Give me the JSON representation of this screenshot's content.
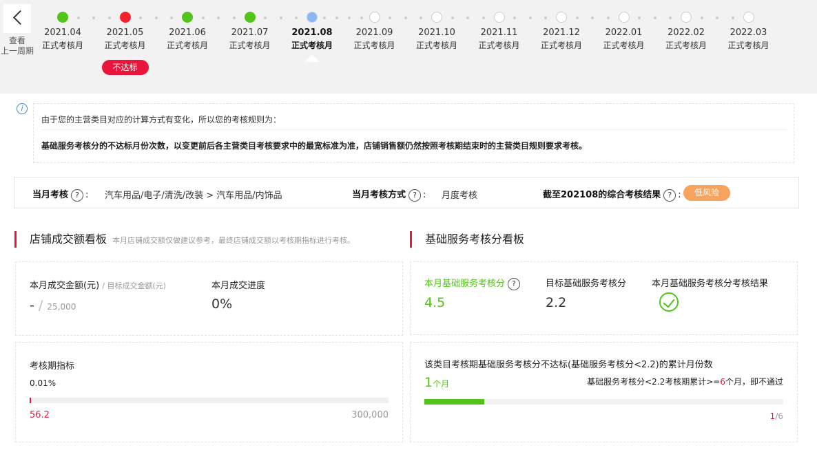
{
  "back": {
    "label_line1": "查看",
    "label_line2": "上一周期"
  },
  "timeline": [
    {
      "date": "2021.04",
      "type": "正式考核月",
      "status": "green"
    },
    {
      "date": "2021.05",
      "type": "正式考核月",
      "status": "red",
      "badge": "不达标"
    },
    {
      "date": "2021.06",
      "type": "正式考核月",
      "status": "green"
    },
    {
      "date": "2021.07",
      "type": "正式考核月",
      "status": "green"
    },
    {
      "date": "2021.08",
      "type": "正式考核月",
      "status": "current"
    },
    {
      "date": "2021.09",
      "type": "正式考核月",
      "status": "empty"
    },
    {
      "date": "2021.10",
      "type": "正式考核月",
      "status": "empty"
    },
    {
      "date": "2021.11",
      "type": "正式考核月",
      "status": "empty"
    },
    {
      "date": "2021.12",
      "type": "正式考核月",
      "status": "empty"
    },
    {
      "date": "2022.01",
      "type": "正式考核月",
      "status": "empty"
    },
    {
      "date": "2022.02",
      "type": "正式考核月",
      "status": "empty"
    },
    {
      "date": "2022.03",
      "type": "正式考核月",
      "status": "empty"
    }
  ],
  "notice": {
    "icon_text": "i",
    "line1": "由于您的主营类目对应的计算方式有变化，所以您的考核规则为：",
    "line2": "基础服务考核分的不达标月份次数，以变更前后各主营类目考核要求中的最宽标准为准，店铺销售额仍然按照考核期结束时的主营类目规则要求考核。"
  },
  "assessment": {
    "month_label": "当月考核",
    "category": "汽车用品/电子/清洗/改装 > 汽车用品/内饰品",
    "method_label": "当月考核方式",
    "method_value": "月度考核",
    "result_label": "截至202108的综合考核结果",
    "risk": "低风险"
  },
  "gmv_board": {
    "title": "店铺成交额看板",
    "subtitle": "本月店铺成交额仅做建议参考，最终店铺成交额以考核期指标进行考核。",
    "amount_label": "本月成交金额(元)",
    "target_label": "/ 目标成交金额(元)",
    "amount_value": "-",
    "target_value": "25,000",
    "progress_label": "本月成交进度",
    "progress_value": "0%",
    "period_label": "考核期指标",
    "period_percent": "0.01%",
    "period_current": "56.2",
    "period_target": "300,000",
    "period_fraction": 0.0002
  },
  "service_board": {
    "title": "基础服务考核分看板",
    "score_label": "本月基础服务考核分",
    "score_value": "4.5",
    "target_label": "目标基础服务考核分",
    "target_value": "2.2",
    "result_label": "本月基础服务考核分考核结果",
    "fail_title": "该类目考核期基础服务考核分不达标(基础服务考核分<2.2)的累计月份数",
    "fail_count": "1",
    "fail_unit": "个月",
    "rule_pre": "基础服务考核分<2.2考核期累计>=",
    "rule_num": "6",
    "rule_post": "个月，即不通过",
    "fail_fraction": 0.1667,
    "ratio_num": "1",
    "ratio_den": "/6"
  }
}
